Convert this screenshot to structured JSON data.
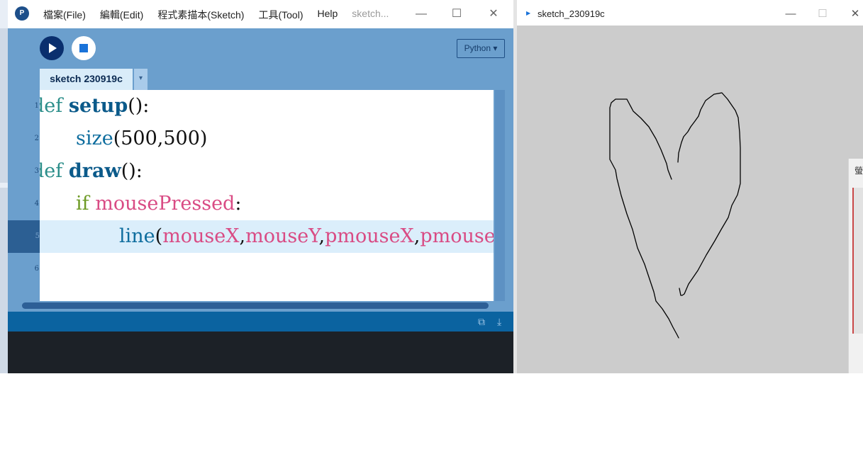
{
  "ide": {
    "menu": [
      "檔案(File)",
      "編輯(Edit)",
      "程式素描本(Sketch)",
      "工具(Tool)",
      "Help"
    ],
    "menu_dim": "sketch...",
    "window_controls": {
      "minimize": "—",
      "maximize": "☐",
      "close": "✕"
    },
    "mode_label": "Python ▾",
    "tab_label": "sketch 230919c",
    "tab_arrow": "▾",
    "code": {
      "line1": {
        "kw": "def",
        "name": "setup",
        "rest": "():"
      },
      "line2": {
        "fn": "size",
        "rest": "(500,500)"
      },
      "line3": {
        "kw": "def",
        "name": "draw",
        "rest": "():"
      },
      "line4": {
        "kw": "if",
        "var": "mousePressed",
        "rest": ":"
      },
      "line5": {
        "fn": "line",
        "open": "(",
        "a": "mouseX",
        "b": "mouseY",
        "c": "pmouseX",
        "d": "pmouseY",
        "close": ")",
        "comma": ","
      }
    },
    "line_numbers": [
      "1",
      "2",
      "3",
      "4",
      "5",
      "6"
    ],
    "active_line": 5
  },
  "sketch": {
    "title": "sketch_230919c",
    "window_controls": {
      "minimize": "—",
      "maximize": "☐",
      "close": "✕"
    },
    "background": "#cccccc",
    "stroke": "#000000"
  },
  "peek": {
    "title": "螢"
  },
  "icons": {
    "app": "processing-logo-icon",
    "run": "play-icon",
    "stop": "stop-icon",
    "console_copy": "copy-icon",
    "console_toggle": "collapse-icon"
  }
}
